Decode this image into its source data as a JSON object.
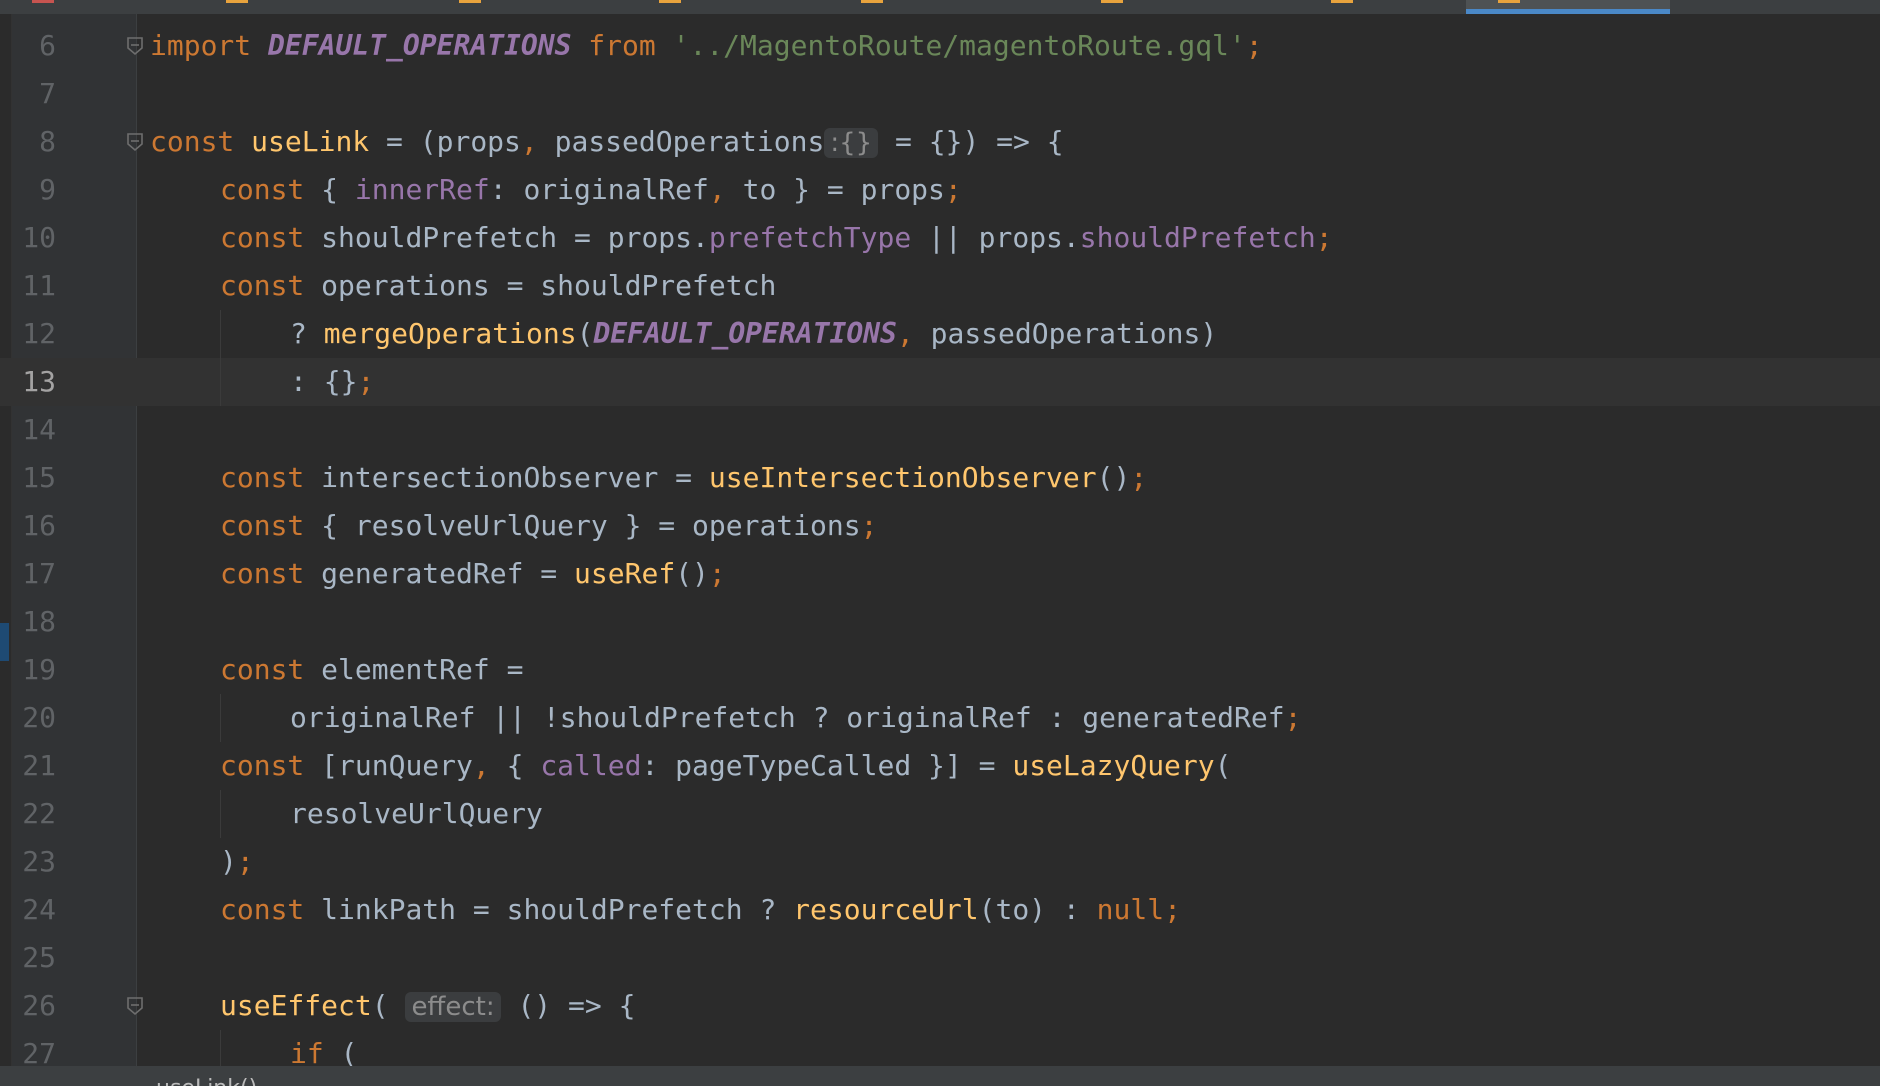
{
  "editor": {
    "language": "javascript",
    "current_line": 13,
    "lines": [
      {
        "n": "6",
        "indent": 0,
        "fold": "open",
        "tokens": [
          {
            "c": "t-kw",
            "t": "import "
          },
          {
            "c": "t-const",
            "t": "DEFAULT_OPERATIONS"
          },
          {
            "c": "t-kw",
            "t": " from "
          },
          {
            "c": "t-str",
            "t": "'../MagentoRoute/magentoRoute.gql'"
          },
          {
            "c": "t-punc",
            "t": ";"
          }
        ]
      },
      {
        "n": "7",
        "indent": 0,
        "tokens": []
      },
      {
        "n": "8",
        "indent": 0,
        "fold": "open",
        "tokens": [
          {
            "c": "t-kw",
            "t": "const "
          },
          {
            "c": "t-fn",
            "t": "useLink"
          },
          {
            "c": "t-id",
            "t": " = (props"
          },
          {
            "c": "t-punc",
            "t": ", "
          },
          {
            "c": "t-id",
            "t": "passedOperations"
          },
          {
            "c": "t-hint",
            "t": ":{}"
          },
          {
            "c": "t-id",
            "t": " = {}) => {"
          }
        ]
      },
      {
        "n": "9",
        "indent": 1,
        "tokens": [
          {
            "c": "t-kw",
            "t": "const "
          },
          {
            "c": "t-id",
            "t": "{ "
          },
          {
            "c": "t-prop",
            "t": "innerRef"
          },
          {
            "c": "t-id",
            "t": ": originalRef"
          },
          {
            "c": "t-punc",
            "t": ", "
          },
          {
            "c": "t-id",
            "t": "to } = props"
          },
          {
            "c": "t-punc",
            "t": ";"
          }
        ]
      },
      {
        "n": "10",
        "indent": 1,
        "tokens": [
          {
            "c": "t-kw",
            "t": "const "
          },
          {
            "c": "t-id",
            "t": "shouldPrefetch = props."
          },
          {
            "c": "t-prop",
            "t": "prefetchType"
          },
          {
            "c": "t-id",
            "t": " || props."
          },
          {
            "c": "t-prop",
            "t": "shouldPrefetch"
          },
          {
            "c": "t-punc",
            "t": ";"
          }
        ]
      },
      {
        "n": "11",
        "indent": 1,
        "tokens": [
          {
            "c": "t-kw",
            "t": "const "
          },
          {
            "c": "t-id",
            "t": "operations = shouldPrefetch"
          }
        ]
      },
      {
        "n": "12",
        "indent": 2,
        "tokens": [
          {
            "c": "t-id",
            "t": "? "
          },
          {
            "c": "t-fn",
            "t": "mergeOperations"
          },
          {
            "c": "t-id",
            "t": "("
          },
          {
            "c": "t-const",
            "t": "DEFAULT_OPERATIONS"
          },
          {
            "c": "t-punc",
            "t": ", "
          },
          {
            "c": "t-id",
            "t": "passedOperations)"
          }
        ]
      },
      {
        "n": "13",
        "indent": 2,
        "tokens": [
          {
            "c": "t-id",
            "t": ": {}"
          },
          {
            "c": "t-punc",
            "t": ";"
          }
        ]
      },
      {
        "n": "14",
        "indent": 0,
        "tokens": []
      },
      {
        "n": "15",
        "indent": 1,
        "tokens": [
          {
            "c": "t-kw",
            "t": "const "
          },
          {
            "c": "t-id",
            "t": "intersectionObserver = "
          },
          {
            "c": "t-fn",
            "t": "useIntersectionObserver"
          },
          {
            "c": "t-id",
            "t": "()"
          },
          {
            "c": "t-punc",
            "t": ";"
          }
        ]
      },
      {
        "n": "16",
        "indent": 1,
        "tokens": [
          {
            "c": "t-kw",
            "t": "const "
          },
          {
            "c": "t-id",
            "t": "{ resolveUrlQuery } = operations"
          },
          {
            "c": "t-punc",
            "t": ";"
          }
        ]
      },
      {
        "n": "17",
        "indent": 1,
        "tokens": [
          {
            "c": "t-kw",
            "t": "const "
          },
          {
            "c": "t-id",
            "t": "generatedRef = "
          },
          {
            "c": "t-fn",
            "t": "useRef"
          },
          {
            "c": "t-id",
            "t": "()"
          },
          {
            "c": "t-punc",
            "t": ";"
          }
        ]
      },
      {
        "n": "18",
        "indent": 0,
        "tokens": []
      },
      {
        "n": "19",
        "indent": 1,
        "tokens": [
          {
            "c": "t-kw",
            "t": "const "
          },
          {
            "c": "t-id",
            "t": "elementRef ="
          }
        ]
      },
      {
        "n": "20",
        "indent": 2,
        "tokens": [
          {
            "c": "t-id",
            "t": "originalRef || !shouldPrefetch ? originalRef : generatedRef"
          },
          {
            "c": "t-punc",
            "t": ";"
          }
        ]
      },
      {
        "n": "21",
        "indent": 1,
        "tokens": [
          {
            "c": "t-kw",
            "t": "const "
          },
          {
            "c": "t-id",
            "t": "[runQuery"
          },
          {
            "c": "t-punc",
            "t": ", "
          },
          {
            "c": "t-id",
            "t": "{ "
          },
          {
            "c": "t-prop",
            "t": "called"
          },
          {
            "c": "t-id",
            "t": ": pageTypeCalled }] = "
          },
          {
            "c": "t-fn",
            "t": "useLazyQuery"
          },
          {
            "c": "t-id",
            "t": "("
          }
        ]
      },
      {
        "n": "22",
        "indent": 2,
        "tokens": [
          {
            "c": "t-id",
            "t": "resolveUrlQuery"
          }
        ]
      },
      {
        "n": "23",
        "indent": 1,
        "tokens": [
          {
            "c": "t-id",
            "t": ")"
          },
          {
            "c": "t-punc",
            "t": ";"
          }
        ]
      },
      {
        "n": "24",
        "indent": 1,
        "tokens": [
          {
            "c": "t-kw",
            "t": "const "
          },
          {
            "c": "t-id",
            "t": "linkPath = shouldPrefetch ? "
          },
          {
            "c": "t-fn",
            "t": "resourceUrl"
          },
          {
            "c": "t-id",
            "t": "(to) : "
          },
          {
            "c": "t-kw",
            "t": "null"
          },
          {
            "c": "t-punc",
            "t": ";"
          }
        ]
      },
      {
        "n": "25",
        "indent": 0,
        "tokens": []
      },
      {
        "n": "26",
        "indent": 1,
        "fold": "open",
        "tokens": [
          {
            "c": "t-fn",
            "t": "useEffect"
          },
          {
            "c": "t-id",
            "t": "( "
          },
          {
            "c": "t-hint",
            "t": "effect:"
          },
          {
            "c": "t-id",
            "t": " () => {"
          }
        ]
      },
      {
        "n": "27",
        "indent": 2,
        "tokens": [
          {
            "c": "t-kw",
            "t": "if "
          },
          {
            "c": "t-id",
            "t": "("
          }
        ]
      }
    ]
  },
  "breadcrumb": {
    "label": "useLink()"
  },
  "tabs": [
    {
      "color": "#c75450"
    },
    {
      "color": "#e8a33d"
    },
    {
      "color": "#e8a33d"
    },
    {
      "color": "#e8a33d"
    },
    {
      "color": "#e8a33d"
    },
    {
      "color": "#e8a33d"
    },
    {
      "color": "#e8a33d"
    },
    {
      "color": "#e8a33d",
      "active": true
    }
  ]
}
